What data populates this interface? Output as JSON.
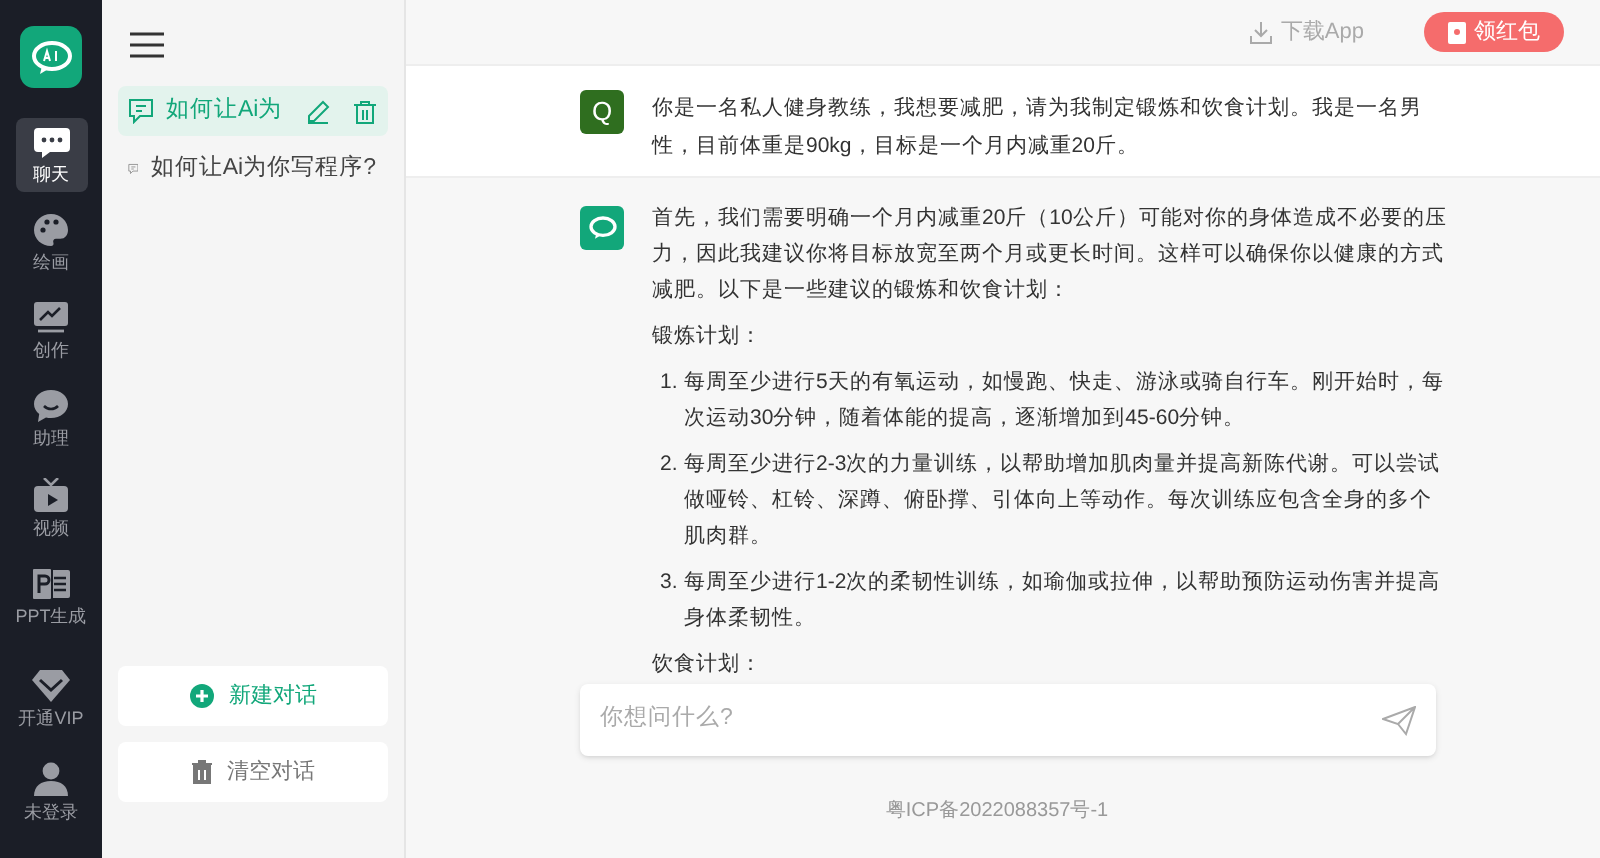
{
  "nav": [
    {
      "kind": "chat",
      "label": "聊天",
      "selected": true
    },
    {
      "kind": "paint",
      "label": "绘画",
      "selected": false
    },
    {
      "kind": "create",
      "label": "创作",
      "selected": false
    },
    {
      "kind": "assistant",
      "label": "助理",
      "selected": false
    },
    {
      "kind": "video",
      "label": "视频",
      "selected": false
    },
    {
      "kind": "ppt",
      "label": "PPT生成",
      "selected": false
    }
  ],
  "nav_bottom": [
    {
      "kind": "vip",
      "label": "开通VIP"
    },
    {
      "kind": "user",
      "label": "未登录"
    }
  ],
  "conversations": [
    {
      "title": "如何让Ai为",
      "selected": true
    },
    {
      "title": "如何让Ai为你写程序?",
      "selected": false
    }
  ],
  "new_chat": "新建对话",
  "clear_chats": "清空对话",
  "header": {
    "download": "下载App",
    "red_packet": "领红包"
  },
  "question": {
    "avatar": "Q",
    "text": "你是一名私人健身教练，我想要减肥，请为我制定锻炼和饮食计划。我是一名男性，目前体重是90kg，目标是一个月内减重20斤。"
  },
  "answer": [
    {
      "kind": "paragraph",
      "text": "首先，我们需要明确一个月内减重20斤（10公斤）可能对你的身体造成不必要的压力，因此我建议你将目标放宽至两个月或更长时间。这样可以确保你以健康的方式减肥。以下是一些建议的锻炼和饮食计划："
    },
    {
      "kind": "paragraph",
      "text": "锻炼计划："
    },
    {
      "kind": "list",
      "items": [
        {
          "number": "1.",
          "text": "每周至少进行5天的有氧运动，如慢跑、快走、游泳或骑自行车。刚开始时，每次运动30分钟，随着体能的提高，逐渐增加到45-60分钟。"
        },
        {
          "number": "2.",
          "text": "每周至少进行2-3次的力量训练，以帮助增加肌肉量并提高新陈代谢。可以尝试做哑铃、杠铃、深蹲、俯卧撑、引体向上等动作。每次训练应包含全身的多个肌肉群。"
        },
        {
          "number": "3.",
          "text": "每周至少进行1-2次的柔韧性训练，如瑜伽或拉伸，以帮助预防运动伤害并提高身体柔韧性。"
        }
      ]
    },
    {
      "kind": "paragraph",
      "text": "饮食计划："
    }
  ],
  "input": {
    "placeholder": "你想问什么?"
  },
  "footer": "粤ICP备2022088357号-1"
}
